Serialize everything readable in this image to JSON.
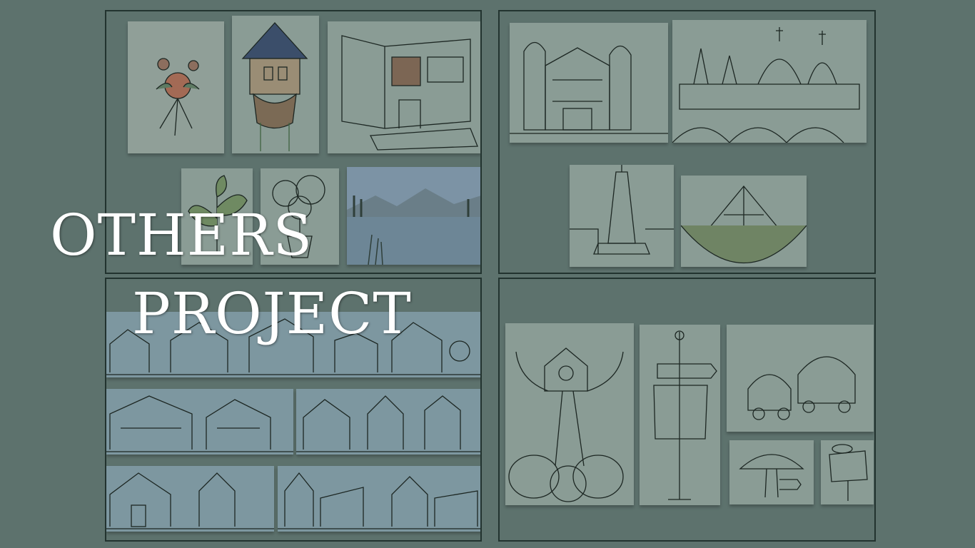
{
  "title": {
    "line1": "OTHERS",
    "line2": "PROJECT"
  },
  "colors": {
    "background": "#5d726d",
    "panel_border": "#22332f",
    "title_text": "#ffffff"
  },
  "panels": [
    {
      "id": "panel-illustrations",
      "tiles": [
        "flower-bouquet-painting",
        "fairytale-tower-sketch",
        "modern-house-sketch",
        "leaf-plant-sketch",
        "potted-plant-sketch",
        "lake-landscape-painting"
      ]
    },
    {
      "id": "panel-landmark-sketches",
      "tiles": [
        "colonial-building-sketch",
        "cathedral-domes-sketch",
        "monument-tower-sketch",
        "pyramid-structure-sketch"
      ]
    },
    {
      "id": "panel-building-elevations",
      "tiles": [
        "elevation-row-1",
        "elevation-row-2a",
        "elevation-row-2b",
        "elevation-row-3a",
        "elevation-row-3b"
      ]
    },
    {
      "id": "panel-concept-sketches",
      "tiles": [
        "treehouse-sketch",
        "signpost-sketch",
        "caravan-wagon-sketch",
        "mushroom-sign-sketch",
        "tour-sign-sketch"
      ]
    }
  ]
}
